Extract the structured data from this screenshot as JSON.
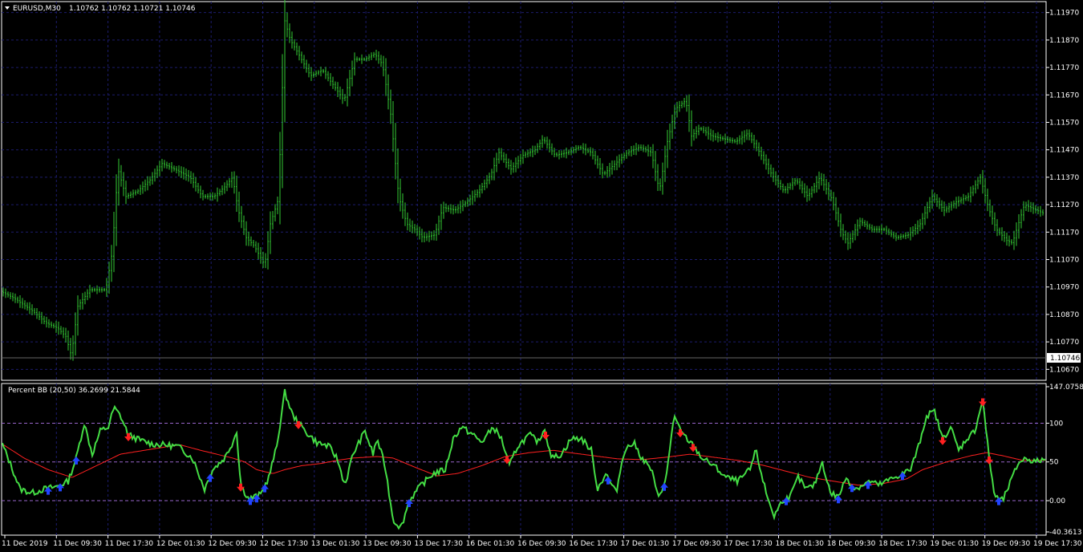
{
  "main_pane": {
    "symbol": "EURUSD,M30",
    "ohlc": "1.10762 1.10762 1.10721 1.10746",
    "price_ticks": [
      "1.11970",
      "1.11870",
      "1.11770",
      "1.11670",
      "1.11570",
      "1.11470",
      "1.11370",
      "1.11270",
      "1.11170",
      "1.11070",
      "1.10970",
      "1.10870",
      "1.10770",
      "1.10670"
    ],
    "current_price": "1.10746",
    "bar_color": "#33cc33",
    "grid_color": "#1c1c6e",
    "axis_color": "#ffffff"
  },
  "indicator_pane": {
    "title": "Percent BB (20,50) 36.2699 21.5844",
    "ticks": [
      "147.0758",
      "100",
      "50",
      "0.00",
      "-40.3613"
    ],
    "line_color": "#44dd44",
    "signal_color": "#ff2020",
    "up_arrow_color": "#2244ff",
    "down_arrow_color": "#ff2020",
    "level_color": "#9966cc"
  },
  "time_axis": {
    "labels": [
      "11 Dec 2019",
      "11 Dec 09:30",
      "11 Dec 17:30",
      "12 Dec 01:30",
      "12 Dec 09:30",
      "12 Dec 17:30",
      "13 Dec 01:30",
      "13 Dec 09:30",
      "13 Dec 17:30",
      "16 Dec 01:30",
      "16 Dec 09:30",
      "16 Dec 17:30",
      "17 Dec 01:30",
      "17 Dec 09:30",
      "17 Dec 17:30",
      "18 Dec 01:30",
      "18 Dec 09:30",
      "18 Dec 17:30",
      "19 Dec 01:30",
      "19 Dec 09:30",
      "19 Dec 17:30"
    ]
  },
  "chart_data": {
    "type": "line",
    "price_anchors": [
      [
        0,
        1.1096
      ],
      [
        20,
        1.1093
      ],
      [
        45,
        1.1088
      ],
      [
        60,
        1.1084
      ],
      [
        75,
        1.1082
      ],
      [
        85,
        1.1079
      ],
      [
        92,
        1.1072
      ],
      [
        100,
        1.109
      ],
      [
        115,
        1.1096
      ],
      [
        135,
        1.1096
      ],
      [
        143,
        1.111
      ],
      [
        150,
        1.114
      ],
      [
        160,
        1.113
      ],
      [
        175,
        1.1132
      ],
      [
        190,
        1.1136
      ],
      [
        205,
        1.1142
      ],
      [
        220,
        1.114
      ],
      [
        240,
        1.1137
      ],
      [
        255,
        1.113
      ],
      [
        270,
        1.113
      ],
      [
        285,
        1.1134
      ],
      [
        293,
        1.1137
      ],
      [
        300,
        1.1125
      ],
      [
        310,
        1.1115
      ],
      [
        320,
        1.1112
      ],
      [
        333,
        1.1105
      ],
      [
        340,
        1.112
      ],
      [
        350,
        1.1129
      ],
      [
        358,
        1.1194
      ],
      [
        365,
        1.1187
      ],
      [
        375,
        1.1182
      ],
      [
        390,
        1.1174
      ],
      [
        405,
        1.1176
      ],
      [
        420,
        1.117
      ],
      [
        432,
        1.1165
      ],
      [
        445,
        1.118
      ],
      [
        458,
        1.118
      ],
      [
        470,
        1.1182
      ],
      [
        480,
        1.1178
      ],
      [
        490,
        1.116
      ],
      [
        500,
        1.113
      ],
      [
        510,
        1.112
      ],
      [
        520,
        1.1118
      ],
      [
        530,
        1.1115
      ],
      [
        545,
        1.1116
      ],
      [
        555,
        1.1126
      ],
      [
        570,
        1.1125
      ],
      [
        585,
        1.1128
      ],
      [
        600,
        1.1132
      ],
      [
        615,
        1.1138
      ],
      [
        625,
        1.1146
      ],
      [
        640,
        1.114
      ],
      [
        655,
        1.1145
      ],
      [
        670,
        1.1147
      ],
      [
        680,
        1.1151
      ],
      [
        695,
        1.1145
      ],
      [
        710,
        1.1146
      ],
      [
        725,
        1.1148
      ],
      [
        740,
        1.1146
      ],
      [
        755,
        1.1138
      ],
      [
        770,
        1.1142
      ],
      [
        785,
        1.1146
      ],
      [
        800,
        1.1148
      ],
      [
        815,
        1.1146
      ],
      [
        825,
        1.1132
      ],
      [
        835,
        1.115
      ],
      [
        845,
        1.1162
      ],
      [
        858,
        1.1165
      ],
      [
        865,
        1.1152
      ],
      [
        875,
        1.1155
      ],
      [
        890,
        1.1152
      ],
      [
        905,
        1.1151
      ],
      [
        920,
        1.115
      ],
      [
        935,
        1.1153
      ],
      [
        950,
        1.1146
      ],
      [
        965,
        1.1138
      ],
      [
        980,
        1.1132
      ],
      [
        995,
        1.1136
      ],
      [
        1010,
        1.113
      ],
      [
        1025,
        1.1137
      ],
      [
        1040,
        1.1129
      ],
      [
        1052,
        1.1117
      ],
      [
        1060,
        1.1113
      ],
      [
        1075,
        1.1121
      ],
      [
        1090,
        1.1118
      ],
      [
        1105,
        1.1118
      ],
      [
        1120,
        1.1115
      ],
      [
        1135,
        1.1116
      ],
      [
        1150,
        1.112
      ],
      [
        1165,
        1.113
      ],
      [
        1180,
        1.1125
      ],
      [
        1195,
        1.1128
      ],
      [
        1210,
        1.113
      ],
      [
        1225,
        1.1137
      ],
      [
        1235,
        1.1126
      ],
      [
        1245,
        1.1118
      ],
      [
        1258,
        1.1114
      ],
      [
        1265,
        1.1113
      ],
      [
        1280,
        1.1127
      ],
      [
        1295,
        1.1125
      ],
      [
        1303,
        1.1124
      ]
    ],
    "percent_bb_anchors": [
      [
        0,
        80
      ],
      [
        12,
        50
      ],
      [
        25,
        15
      ],
      [
        40,
        10
      ],
      [
        55,
        15
      ],
      [
        70,
        18
      ],
      [
        85,
        25
      ],
      [
        95,
        55
      ],
      [
        105,
        100
      ],
      [
        115,
        60
      ],
      [
        125,
        90
      ],
      [
        135,
        95
      ],
      [
        142,
        120
      ],
      [
        150,
        110
      ],
      [
        160,
        85
      ],
      [
        175,
        78
      ],
      [
        190,
        73
      ],
      [
        205,
        72
      ],
      [
        222,
        70
      ],
      [
        240,
        55
      ],
      [
        255,
        15
      ],
      [
        265,
        40
      ],
      [
        280,
        55
      ],
      [
        290,
        75
      ],
      [
        295,
        90
      ],
      [
        300,
        20
      ],
      [
        310,
        2
      ],
      [
        325,
        8
      ],
      [
        335,
        30
      ],
      [
        345,
        70
      ],
      [
        355,
        140
      ],
      [
        365,
        110
      ],
      [
        380,
        90
      ],
      [
        395,
        75
      ],
      [
        410,
        70
      ],
      [
        420,
        55
      ],
      [
        430,
        20
      ],
      [
        440,
        60
      ],
      [
        455,
        90
      ],
      [
        465,
        60
      ],
      [
        470,
        80
      ],
      [
        480,
        45
      ],
      [
        490,
        -25
      ],
      [
        500,
        -35
      ],
      [
        510,
        0
      ],
      [
        525,
        20
      ],
      [
        540,
        35
      ],
      [
        555,
        40
      ],
      [
        565,
        80
      ],
      [
        575,
        95
      ],
      [
        590,
        85
      ],
      [
        600,
        75
      ],
      [
        615,
        95
      ],
      [
        625,
        80
      ],
      [
        635,
        45
      ],
      [
        645,
        70
      ],
      [
        660,
        85
      ],
      [
        672,
        75
      ],
      [
        678,
        95
      ],
      [
        688,
        55
      ],
      [
        700,
        60
      ],
      [
        712,
        80
      ],
      [
        725,
        80
      ],
      [
        737,
        65
      ],
      [
        745,
        15
      ],
      [
        755,
        35
      ],
      [
        768,
        10
      ],
      [
        778,
        65
      ],
      [
        790,
        75
      ],
      [
        800,
        55
      ],
      [
        812,
        40
      ],
      [
        820,
        5
      ],
      [
        830,
        25
      ],
      [
        840,
        110
      ],
      [
        848,
        90
      ],
      [
        856,
        80
      ],
      [
        865,
        70
      ],
      [
        875,
        55
      ],
      [
        890,
        45
      ],
      [
        905,
        30
      ],
      [
        920,
        25
      ],
      [
        935,
        40
      ],
      [
        942,
        65
      ],
      [
        955,
        10
      ],
      [
        965,
        -20
      ],
      [
        975,
        0
      ],
      [
        985,
        5
      ],
      [
        995,
        30
      ],
      [
        1005,
        15
      ],
      [
        1015,
        20
      ],
      [
        1025,
        50
      ],
      [
        1035,
        10
      ],
      [
        1045,
        5
      ],
      [
        1055,
        30
      ],
      [
        1065,
        15
      ],
      [
        1075,
        20
      ],
      [
        1085,
        25
      ],
      [
        1095,
        20
      ],
      [
        1105,
        25
      ],
      [
        1115,
        30
      ],
      [
        1125,
        35
      ],
      [
        1135,
        40
      ],
      [
        1145,
        70
      ],
      [
        1155,
        110
      ],
      [
        1165,
        115
      ],
      [
        1175,
        80
      ],
      [
        1185,
        95
      ],
      [
        1195,
        65
      ],
      [
        1205,
        80
      ],
      [
        1215,
        90
      ],
      [
        1225,
        130
      ],
      [
        1233,
        55
      ],
      [
        1240,
        5
      ],
      [
        1250,
        0
      ],
      [
        1260,
        25
      ],
      [
        1270,
        50
      ],
      [
        1280,
        55
      ],
      [
        1290,
        50
      ],
      [
        1300,
        53
      ]
    ],
    "signal_anchors": [
      [
        0,
        75
      ],
      [
        30,
        55
      ],
      [
        60,
        40
      ],
      [
        90,
        30
      ],
      [
        120,
        45
      ],
      [
        150,
        60
      ],
      [
        180,
        65
      ],
      [
        210,
        70
      ],
      [
        225,
        72
      ],
      [
        250,
        65
      ],
      [
        270,
        60
      ],
      [
        290,
        55
      ],
      [
        305,
        50
      ],
      [
        320,
        40
      ],
      [
        340,
        35
      ],
      [
        355,
        40
      ],
      [
        375,
        45
      ],
      [
        400,
        48
      ],
      [
        420,
        52
      ],
      [
        440,
        55
      ],
      [
        470,
        57
      ],
      [
        490,
        55
      ],
      [
        520,
        42
      ],
      [
        545,
        32
      ],
      [
        570,
        35
      ],
      [
        600,
        45
      ],
      [
        630,
        57
      ],
      [
        660,
        62
      ],
      [
        690,
        65
      ],
      [
        710,
        62
      ],
      [
        740,
        58
      ],
      [
        770,
        54
      ],
      [
        800,
        53
      ],
      [
        830,
        56
      ],
      [
        860,
        60
      ],
      [
        890,
        56
      ],
      [
        920,
        52
      ],
      [
        950,
        46
      ],
      [
        980,
        38
      ],
      [
        1010,
        30
      ],
      [
        1040,
        25
      ],
      [
        1070,
        20
      ],
      [
        1100,
        22
      ],
      [
        1130,
        28
      ],
      [
        1150,
        40
      ],
      [
        1180,
        50
      ],
      [
        1210,
        58
      ],
      [
        1230,
        62
      ],
      [
        1250,
        58
      ],
      [
        1275,
        52
      ],
      [
        1303,
        52
      ]
    ],
    "up_arrows": [
      60,
      75,
      95,
      262,
      312,
      320,
      330,
      510,
      758,
      828,
      980,
      1045,
      1062,
      1082,
      1125,
      1245
    ],
    "down_arrows": [
      160,
      372,
      300,
      632,
      680,
      848,
      864,
      1175,
      1225,
      1233
    ]
  }
}
